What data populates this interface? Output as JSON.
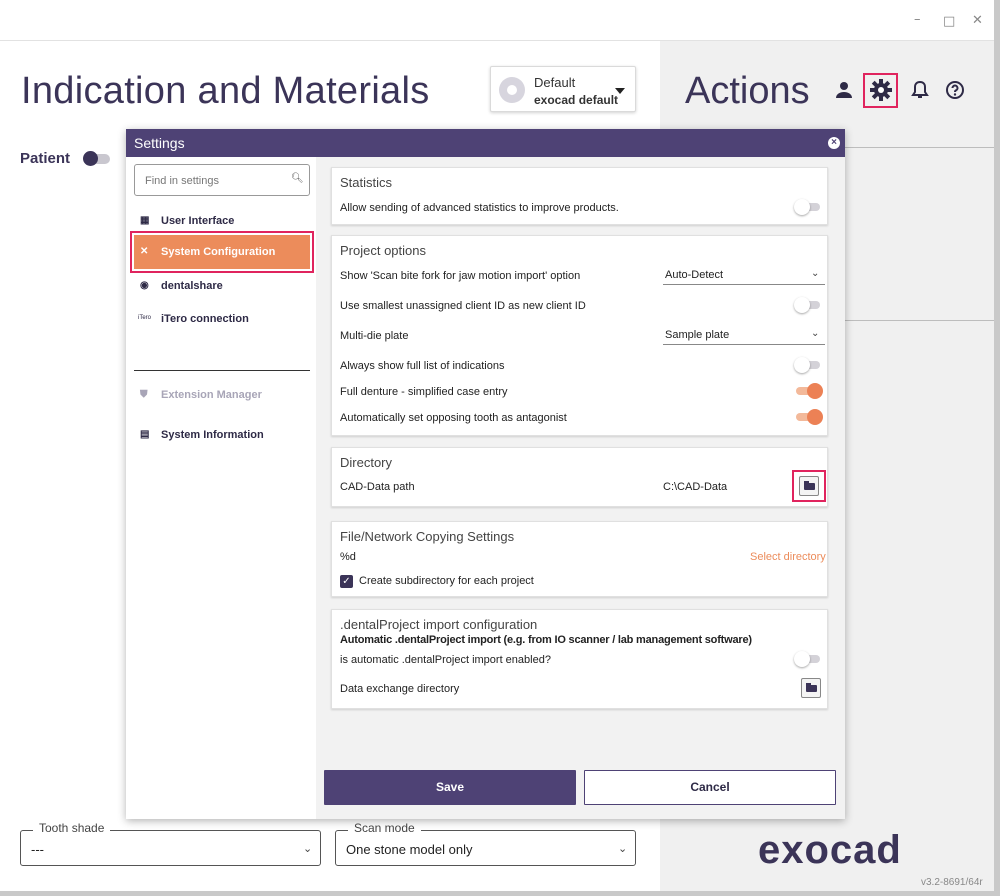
{
  "window": {
    "controls": {
      "minimize": "–",
      "maximize": "□",
      "close": "✕"
    }
  },
  "header": {
    "title": "Indication and Materials",
    "profile": {
      "name": "Default",
      "value": "exocad default"
    },
    "actions_title": "Actions",
    "icons": [
      "user-icon",
      "gear-icon",
      "bell-icon",
      "help-icon"
    ]
  },
  "patient": {
    "label": "Patient"
  },
  "bottom": {
    "tooth_shade": {
      "label": "Tooth shade",
      "value": "---"
    },
    "scan_mode": {
      "label": "Scan mode",
      "value": "One stone model only"
    },
    "brand": "exocad",
    "version": "v3.2-8691/64r"
  },
  "settings": {
    "title": "Settings",
    "search_placeholder": "Find in settings",
    "nav": [
      {
        "label": "User Interface",
        "icon": "user-interface-icon"
      },
      {
        "label": "System Configuration",
        "icon": "tools-icon",
        "active": true
      },
      {
        "label": "dentalshare",
        "icon": "dentalshare-icon"
      },
      {
        "label": "iTero connection",
        "icon": "itero-icon",
        "icon_text": "iTero"
      },
      {
        "label": "Extension Manager",
        "icon": "shield-icon",
        "disabled": true
      },
      {
        "label": "System Information",
        "icon": "info-icon"
      }
    ],
    "statistics": {
      "title": "Statistics",
      "allow_label": "Allow sending of advanced statistics to improve products.",
      "allow_enabled": false
    },
    "project_options": {
      "title": "Project options",
      "scan_bite_label": "Show 'Scan bite fork for jaw motion import' option",
      "scan_bite_value": "Auto-Detect",
      "client_id_label": "Use smallest unassigned client ID as new client ID",
      "client_id_enabled": false,
      "multi_die_label": "Multi-die plate",
      "multi_die_value": "Sample plate",
      "full_list_label": "Always show full list of indications",
      "full_list_enabled": false,
      "full_denture_label": "Full denture - simplified case entry",
      "full_denture_enabled": true,
      "antagonist_label": "Automatically set opposing tooth as antagonist",
      "antagonist_enabled": true
    },
    "directory": {
      "title": "Directory",
      "cad_label": "CAD-Data path",
      "cad_value": "C:\\CAD-Data"
    },
    "file_copy": {
      "title": "File/Network Copying Settings",
      "pattern": "%d",
      "select_dir": "Select directory",
      "subdir_label": "Create subdirectory for each project",
      "subdir_checked": true
    },
    "import": {
      "title": ".dentalProject import configuration",
      "heading": "Automatic .dentalProject import (e.g. from IO scanner / lab management software)",
      "enabled_label": "is automatic .dentalProject import enabled?",
      "enabled": false,
      "exchange_label": "Data exchange directory"
    },
    "buttons": {
      "save": "Save",
      "cancel": "Cancel"
    }
  },
  "colors": {
    "accent": "#ec8c5b",
    "primary": "#4e4275",
    "highlight": "#e0245e"
  }
}
